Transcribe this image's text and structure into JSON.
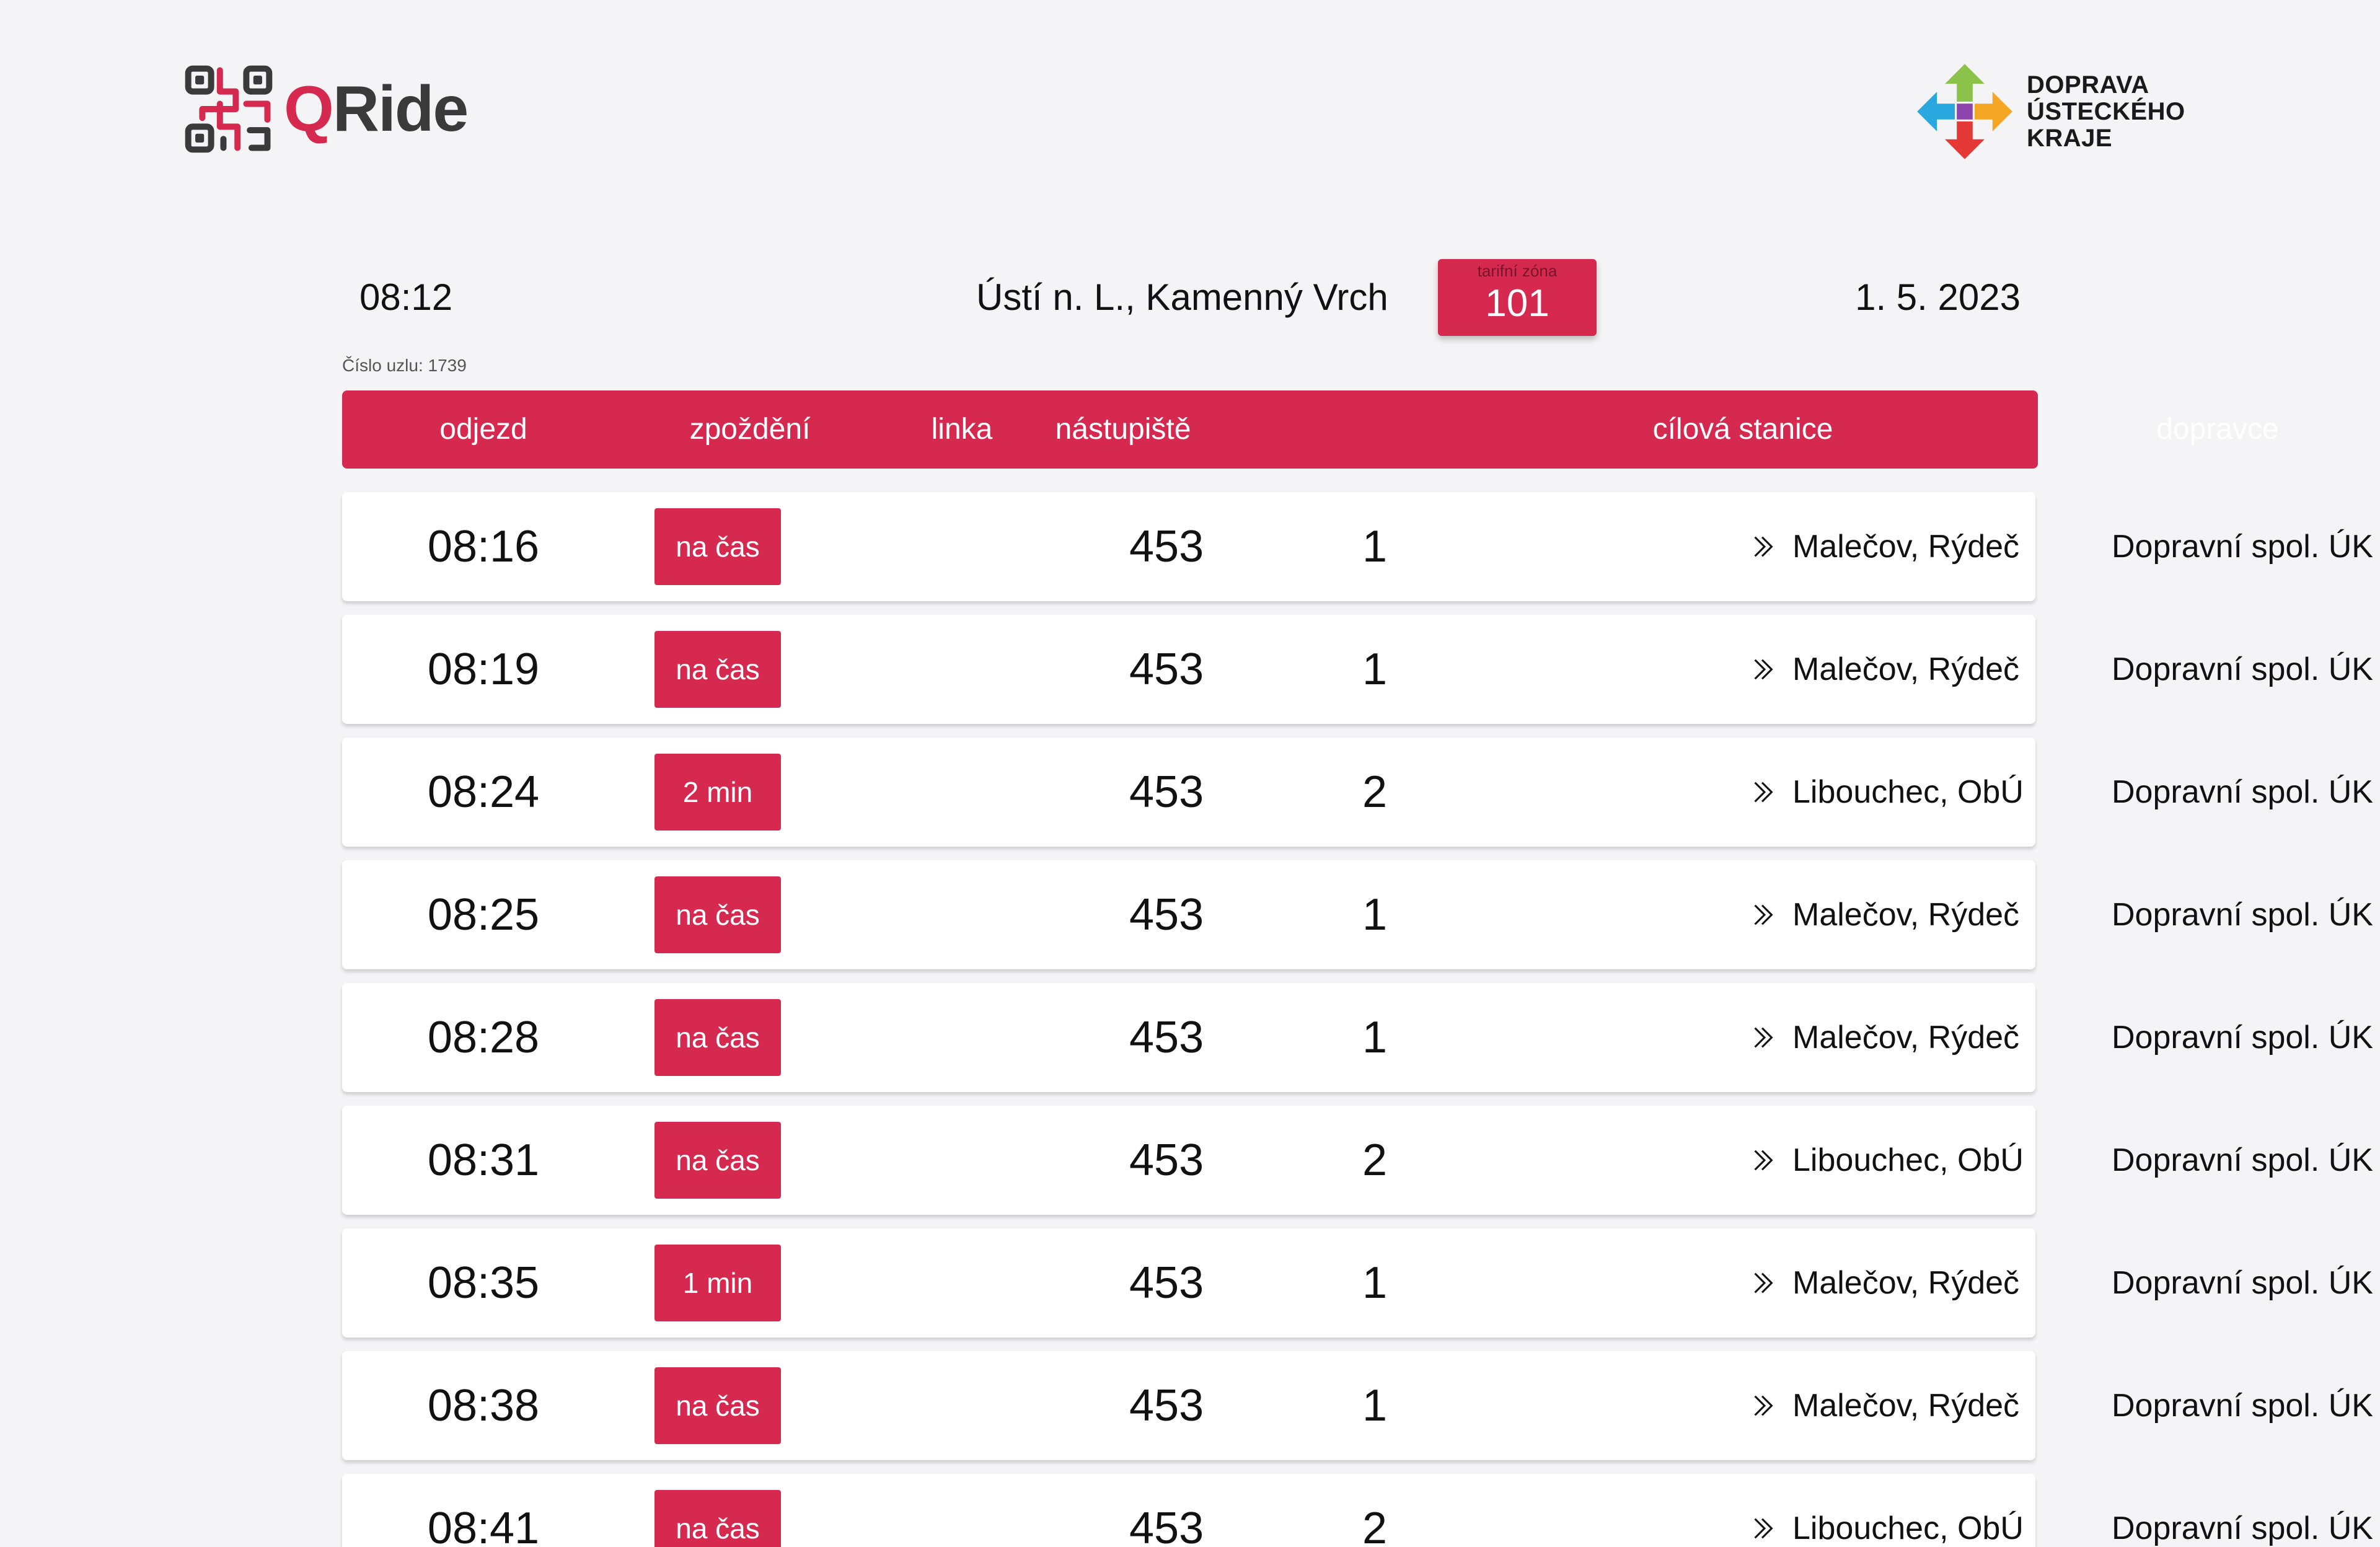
{
  "brand": {
    "name_q": "Q",
    "name_rest": "Ride",
    "partner_lines": [
      "DOPRAVA",
      "ÚSTECKÉHO",
      "KRAJE"
    ]
  },
  "colors": {
    "accent": "#d6294f",
    "background": "#f4f4f6"
  },
  "info": {
    "time": "08:12",
    "station": "Ústí n. L., Kamenný Vrch",
    "zone_label": "tarifní zóna",
    "zone_value": "101",
    "date": "1. 5. 2023",
    "node_number": "Číslo uzlu: 1739"
  },
  "table": {
    "headers": {
      "departure": "odjezd",
      "delay": "zpoždění",
      "line": "linka",
      "platform": "nástupiště",
      "destination": "cílová stanice",
      "carrier": "dopravce"
    },
    "rows": [
      {
        "departure": "08:16",
        "delay": "na čas",
        "line": "453",
        "platform": "1",
        "destination": "Malečov, Rýdeč",
        "carrier": "Dopravní spol. ÚK"
      },
      {
        "departure": "08:19",
        "delay": "na čas",
        "line": "453",
        "platform": "1",
        "destination": "Malečov, Rýdeč",
        "carrier": "Dopravní spol. ÚK"
      },
      {
        "departure": "08:24",
        "delay": "2 min",
        "line": "453",
        "platform": "2",
        "destination": "Libouchec, ObÚ",
        "carrier": "Dopravní spol. ÚK"
      },
      {
        "departure": "08:25",
        "delay": "na čas",
        "line": "453",
        "platform": "1",
        "destination": "Malečov, Rýdeč",
        "carrier": "Dopravní spol. ÚK"
      },
      {
        "departure": "08:28",
        "delay": "na čas",
        "line": "453",
        "platform": "1",
        "destination": "Malečov, Rýdeč",
        "carrier": "Dopravní spol. ÚK"
      },
      {
        "departure": "08:31",
        "delay": "na čas",
        "line": "453",
        "platform": "2",
        "destination": "Libouchec, ObÚ",
        "carrier": "Dopravní spol. ÚK"
      },
      {
        "departure": "08:35",
        "delay": "1 min",
        "line": "453",
        "platform": "1",
        "destination": "Malečov, Rýdeč",
        "carrier": "Dopravní spol. ÚK"
      },
      {
        "departure": "08:38",
        "delay": "na čas",
        "line": "453",
        "platform": "1",
        "destination": "Malečov, Rýdeč",
        "carrier": "Dopravní spol. ÚK"
      },
      {
        "departure": "08:41",
        "delay": "na čas",
        "line": "453",
        "platform": "2",
        "destination": "Libouchec, ObÚ",
        "carrier": "Dopravní spol. ÚK"
      }
    ]
  }
}
